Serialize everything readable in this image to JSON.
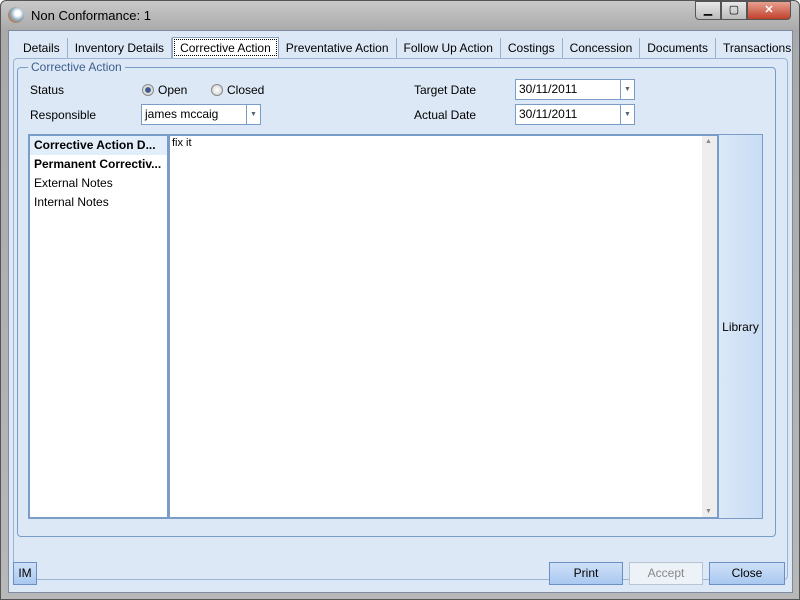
{
  "window": {
    "title": "Non Conformance: 1",
    "minimize": "▁",
    "maximize": "▢",
    "close": "✕"
  },
  "tabs": [
    "Details",
    "Inventory Details",
    "Corrective Action",
    "Preventative Action",
    "Follow Up Action",
    "Costings",
    "Concession",
    "Documents",
    "Transactions"
  ],
  "active_tab": 2,
  "group": {
    "label": "Corrective Action"
  },
  "form": {
    "status_label": "Status",
    "open": "Open",
    "closed": "Closed",
    "status_value": "Open",
    "responsible_label": "Responsible",
    "responsible": "james mccaig",
    "target_label": "Target Date",
    "target": "30/11/2011",
    "actual_label": "Actual Date",
    "actual": "30/11/2011"
  },
  "notes": [
    {
      "label": "Corrective Action D...",
      "bold": true
    },
    {
      "label": "Permanent Correctiv...",
      "bold": true
    },
    {
      "label": "External Notes",
      "bold": false
    },
    {
      "label": "Internal Notes",
      "bold": false
    }
  ],
  "editor": {
    "text": "fix it"
  },
  "library": "Library",
  "buttons": {
    "im": "IM",
    "print": "Print",
    "accept": "Accept",
    "close": "Close"
  }
}
